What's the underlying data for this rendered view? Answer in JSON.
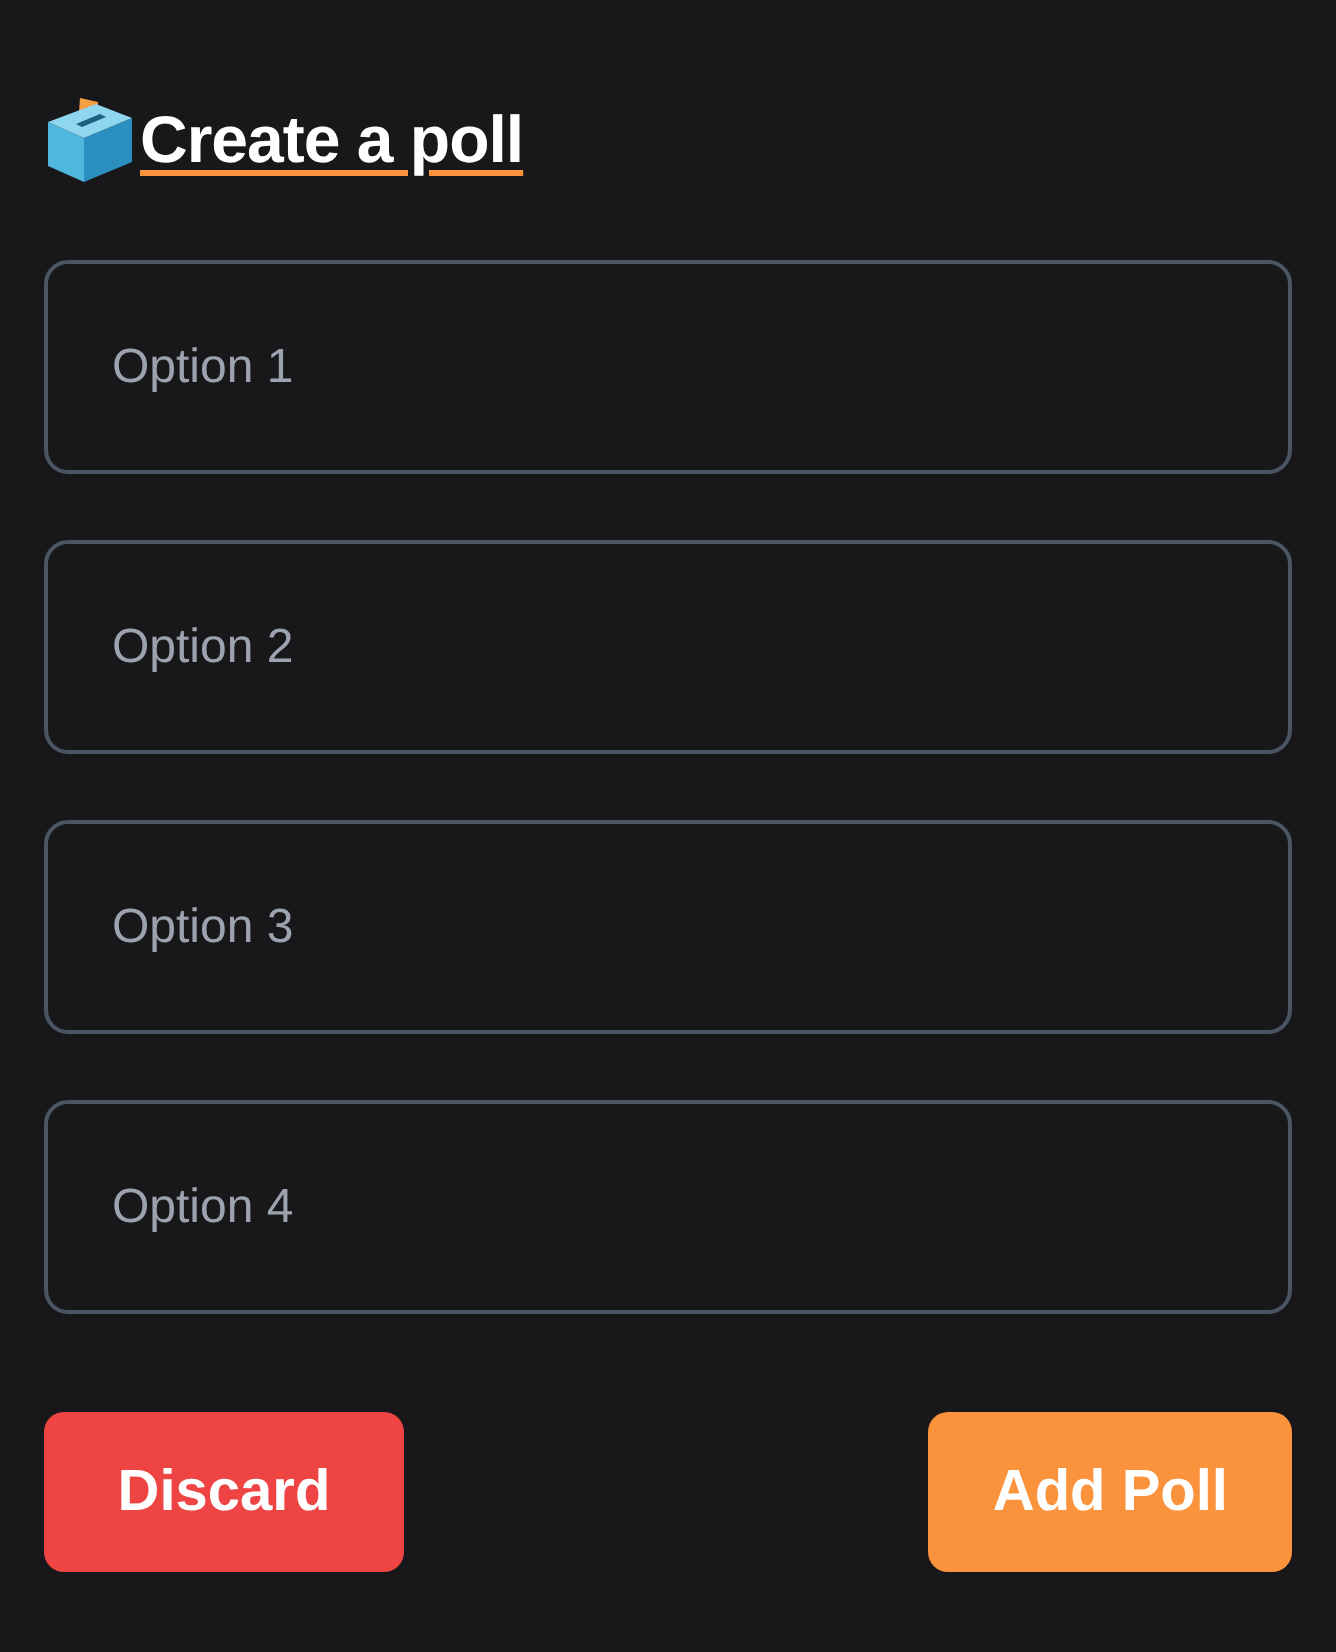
{
  "title": "Create a poll",
  "options": [
    {
      "placeholder": "Option 1"
    },
    {
      "placeholder": "Option 2"
    },
    {
      "placeholder": "Option 3"
    },
    {
      "placeholder": "Option 4"
    }
  ],
  "buttons": [
    {
      "label": "Discard",
      "kind": "danger"
    },
    {
      "label": "Add Poll",
      "kind": "primary"
    }
  ]
}
